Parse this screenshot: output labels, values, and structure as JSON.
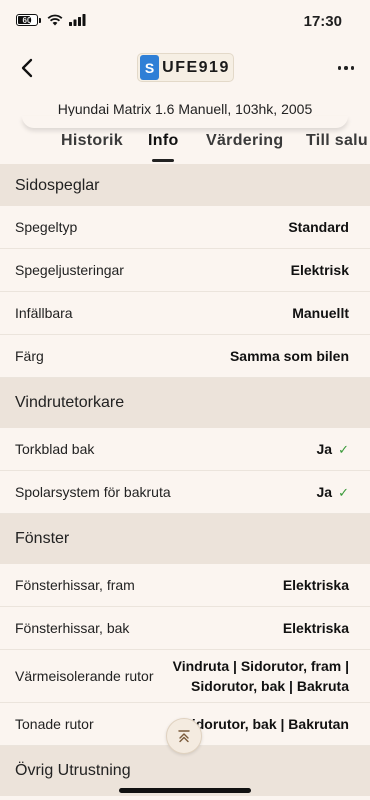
{
  "status_bar": {
    "battery_level": "60",
    "battery_fill": 0.6,
    "time": "17:30"
  },
  "header": {
    "plate_country": "S",
    "plate_number": "UFE919",
    "car_subtitle": "Hyundai Matrix 1.6 Manuell, 103hk, 2005",
    "tabs": [
      {
        "label": "Historik",
        "active": false
      },
      {
        "label": "Info",
        "active": true
      },
      {
        "label": "Värdering",
        "active": false
      },
      {
        "label": "Till salu",
        "active": false
      }
    ]
  },
  "sections": [
    {
      "title": "Sidospeglar",
      "rows": [
        {
          "label": "Spegeltyp",
          "value": "Standard"
        },
        {
          "label": "Spegeljusteringar",
          "value": "Elektrisk"
        },
        {
          "label": "Infällbara",
          "value": "Manuellt"
        },
        {
          "label": "Färg",
          "value": "Samma som bilen"
        }
      ]
    },
    {
      "title": "Vindrutetorkare",
      "rows": [
        {
          "label": "Torkblad bak",
          "value": "Ja",
          "check": "✓"
        },
        {
          "label": "Spolarsystem för bakruta",
          "value": "Ja",
          "check": "✓"
        }
      ]
    },
    {
      "title": "Fönster",
      "rows": [
        {
          "label": "Fönsterhissar, fram",
          "value": "Elektriska"
        },
        {
          "label": "Fönsterhissar, bak",
          "value": "Elektriska"
        },
        {
          "label": "Värmeisolerande rutor",
          "value_line1": "Vindruta | Sidorutor, fram |",
          "value_line2": "Sidorutor, bak | Bakruta"
        },
        {
          "label": "Tonade rutor",
          "value": "Sidorutor, bak | Bakrutan"
        }
      ]
    },
    {
      "title": "Övrig Utrustning"
    }
  ],
  "icons": {
    "back": "chevron-left-icon",
    "more": "more-horizontal-icon",
    "scroll_top": "scroll-to-top-icon",
    "check": "checkmark-icon"
  },
  "colors": {
    "background": "#fbf5f0",
    "section_header": "#ece3da",
    "plate_blue": "#2f7fd6",
    "check_green": "#3a9a3a"
  }
}
